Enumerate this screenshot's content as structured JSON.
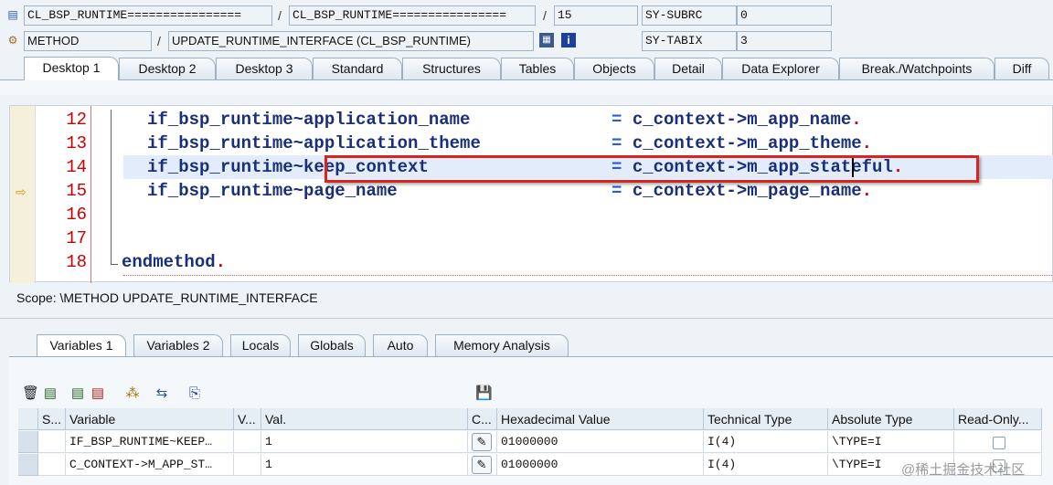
{
  "header": {
    "class_field1": "CL_BSP_RUNTIME================",
    "class_field2": "CL_BSP_RUNTIME================",
    "line_no": "15",
    "subrc_label": "SY-SUBRC",
    "subrc_value": "0",
    "kind": "METHOD",
    "method": "UPDATE_RUNTIME_INTERFACE (CL_BSP_RUNTIME)",
    "tabix_label": "SY-TABIX",
    "tabix_value": "3",
    "slash": "/"
  },
  "tabs": [
    "Desktop 1",
    "Desktop 2",
    "Desktop 3",
    "Standard",
    "Structures",
    "Tables",
    "Objects",
    "Detail",
    "Data Explorer",
    "Break./Watchpoints",
    "Diff"
  ],
  "code": {
    "lines": [
      {
        "num": "12",
        "left": "if_bsp_runtime~application_name",
        "right": "c_context->m_app_name"
      },
      {
        "num": "13",
        "left": "if_bsp_runtime~application_theme",
        "right": "c_context->m_app_theme"
      },
      {
        "num": "14",
        "left": "if_bsp_runtime~keep_context",
        "right": "c_context->m_app_stateful"
      },
      {
        "num": "15",
        "left": "if_bsp_runtime~page_name",
        "right": "c_context->m_page_name"
      },
      {
        "num": "16",
        "left": "",
        "right": ""
      },
      {
        "num": "17",
        "left": "",
        "right": ""
      },
      {
        "num": "18",
        "left": "endmethod",
        "right": ""
      }
    ],
    "eq": "=",
    "dot": "."
  },
  "scope": "Scope: \\METHOD UPDATE_RUNTIME_INTERFACE",
  "var_tabs": [
    "Variables 1",
    "Variables 2",
    "Locals",
    "Globals",
    "Auto",
    "Memory Analysis"
  ],
  "table": {
    "columns": [
      "S...",
      "Variable",
      "V...",
      "Val.",
      "C...",
      "Hexadecimal Value",
      "Technical Type",
      "Absolute Type",
      "Read-Only..."
    ],
    "rows": [
      {
        "variable": "IF_BSP_RUNTIME~KEEP…",
        "value": "1",
        "hex": "01000000",
        "tech": "I(4)",
        "abs": "\\TYPE=I"
      },
      {
        "variable": "C_CONTEXT->M_APP_ST…",
        "value": "1",
        "hex": "01000000",
        "tech": "I(4)",
        "abs": "\\TYPE=I"
      }
    ]
  },
  "watermark": "@稀土掘金技术社区",
  "colors": {
    "accent": "#d9251d",
    "code": "#1a2f7a",
    "line_numbers": "#cc0000"
  }
}
